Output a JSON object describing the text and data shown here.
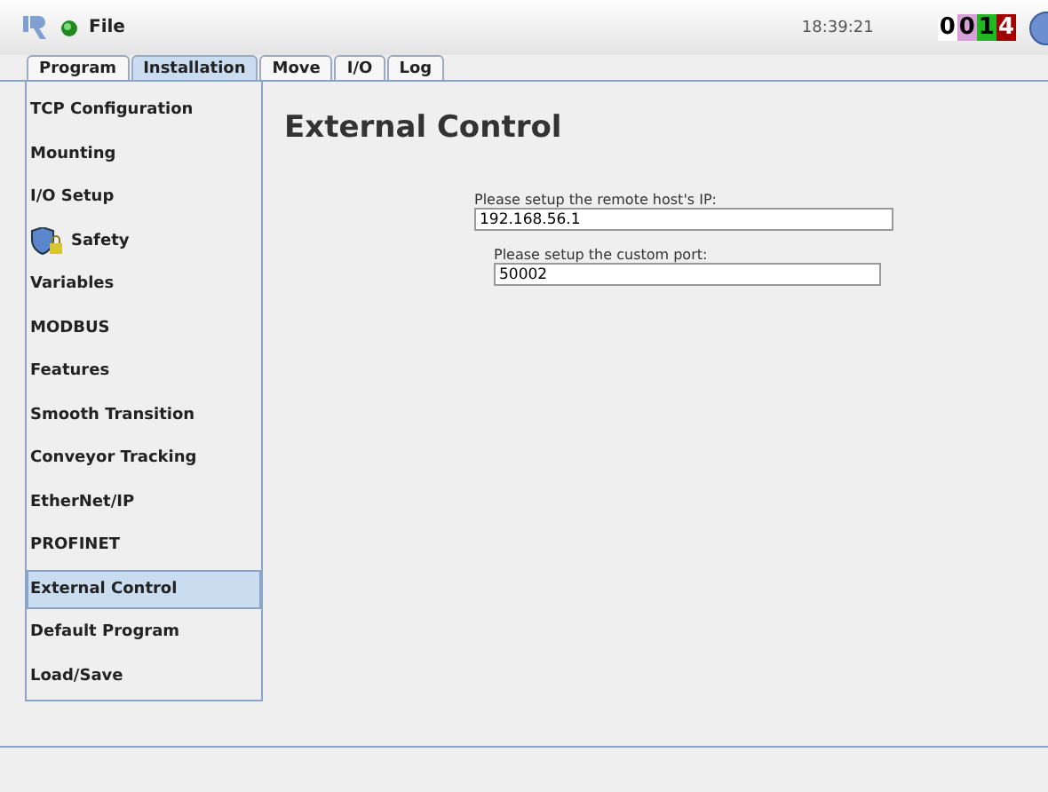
{
  "header": {
    "menu": "File",
    "time": "18:39:21",
    "counter": [
      {
        "digit": "0",
        "color": "#ffffff"
      },
      {
        "digit": "0",
        "color": "#d8a0d8"
      },
      {
        "digit": "1",
        "color": "#22b822"
      },
      {
        "digit": "4",
        "color": "#a00000"
      }
    ]
  },
  "tabs": [
    {
      "label": "Program",
      "selected": false
    },
    {
      "label": "Installation",
      "selected": true
    },
    {
      "label": "Move",
      "selected": false
    },
    {
      "label": "I/O",
      "selected": false
    },
    {
      "label": "Log",
      "selected": false
    }
  ],
  "sidebar": {
    "items": [
      {
        "label": "TCP Configuration",
        "selected": false
      },
      {
        "label": "Mounting",
        "selected": false
      },
      {
        "label": "I/O Setup",
        "selected": false
      },
      {
        "label": "Safety",
        "selected": false,
        "kind": "locked"
      },
      {
        "label": "Variables",
        "selected": false
      },
      {
        "label": "MODBUS",
        "selected": false
      },
      {
        "label": "Features",
        "selected": false
      },
      {
        "label": "Smooth Transition",
        "selected": false
      },
      {
        "label": "Conveyor Tracking",
        "selected": false
      },
      {
        "label": "EtherNet/IP",
        "selected": false
      },
      {
        "label": "PROFINET",
        "selected": false
      },
      {
        "label": "External Control",
        "selected": true
      },
      {
        "label": "Default Program",
        "selected": false
      },
      {
        "label": "Load/Save",
        "selected": false
      }
    ]
  },
  "content": {
    "title": "External Control",
    "fields": [
      {
        "label": "Please setup the remote host's IP:",
        "value": "192.168.56.1"
      },
      {
        "label": "Please setup the custom port:",
        "value": "50002"
      }
    ]
  }
}
